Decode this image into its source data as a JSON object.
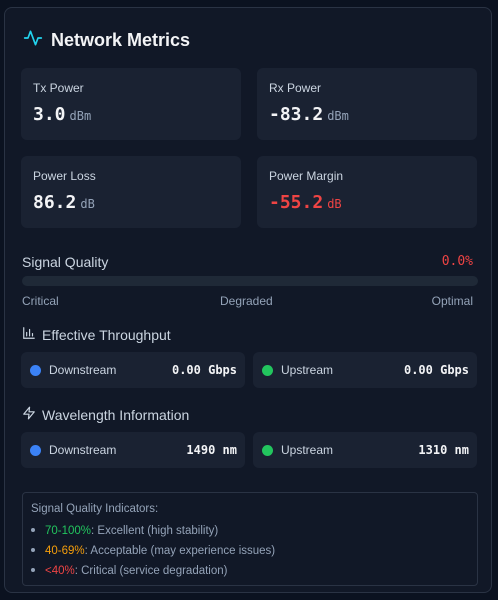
{
  "header": {
    "title": "Network Metrics",
    "icon": "activity-icon",
    "accent": "#22d3ee"
  },
  "metrics": [
    {
      "label": "Tx Power",
      "value": "3.0",
      "unit": "dBm",
      "status": "normal"
    },
    {
      "label": "Rx Power",
      "value": "-83.2",
      "unit": "dBm",
      "status": "normal"
    },
    {
      "label": "Power Loss",
      "value": "86.2",
      "unit": "dB",
      "status": "normal"
    },
    {
      "label": "Power Margin",
      "value": "-55.2",
      "unit": "dB",
      "status": "critical"
    }
  ],
  "signal_quality": {
    "label": "Signal Quality",
    "percent_text": "0.0%",
    "fill_fraction": 0.0,
    "scale": [
      "Critical",
      "Degraded",
      "Optimal"
    ],
    "color": "#ef4444"
  },
  "throughput": {
    "title": "Effective Throughput",
    "icon": "bar-chart-icon",
    "items": [
      {
        "label": "Downstream",
        "value": "0.00 Gbps",
        "dot_color": "#3b82f6"
      },
      {
        "label": "Upstream",
        "value": "0.00 Gbps",
        "dot_color": "#22c55e"
      }
    ]
  },
  "wavelength": {
    "title": "Wavelength Information",
    "icon": "lightning-icon",
    "items": [
      {
        "label": "Downstream",
        "value": "1490 nm",
        "dot_color": "#3b82f6"
      },
      {
        "label": "Upstream",
        "value": "1310 nm",
        "dot_color": "#22c55e"
      }
    ]
  },
  "indicators": {
    "title": "Signal Quality Indicators:",
    "items": [
      {
        "range": "70-100%",
        "text": ": Excellent (high stability)",
        "color": "#22c55e"
      },
      {
        "range": "40-69%",
        "text": ": Acceptable (may experience issues)",
        "color": "#f59e0b"
      },
      {
        "range": "<40%",
        "text": ": Critical (service degradation)",
        "color": "#ef4444"
      }
    ]
  }
}
